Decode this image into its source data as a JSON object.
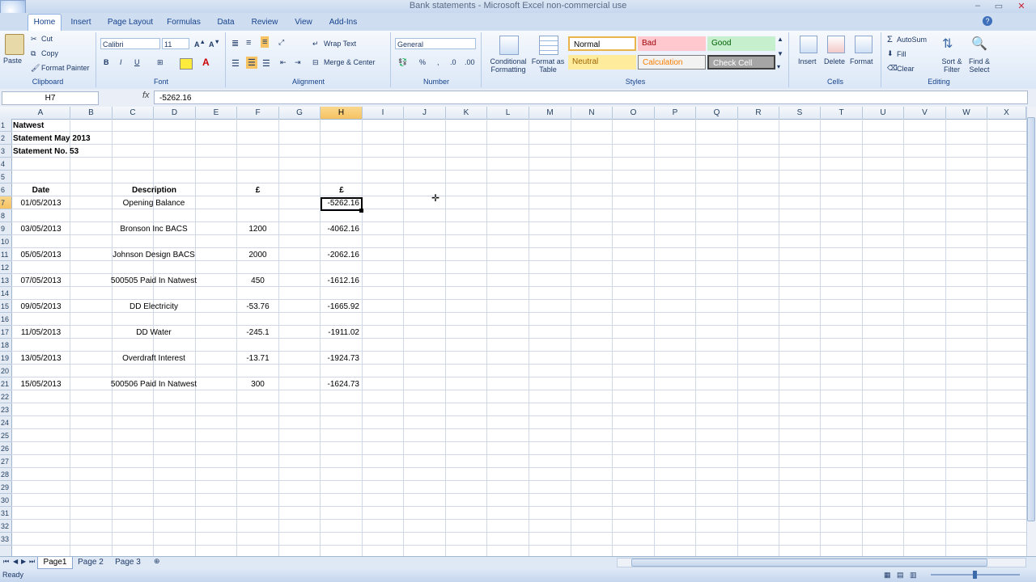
{
  "window": {
    "title": "Bank statements - Microsoft Excel non-commercial use",
    "controls": [
      "–",
      "▭",
      "✕"
    ]
  },
  "tabs": [
    "Home",
    "Insert",
    "Page Layout",
    "Formulas",
    "Data",
    "Review",
    "View",
    "Add-Ins"
  ],
  "ribbon": {
    "clipboard": {
      "label": "Clipboard",
      "paste": "Paste",
      "cut": "Cut",
      "copy": "Copy",
      "format_painter": "Format Painter"
    },
    "font": {
      "label": "Font",
      "name": "Calibri",
      "size": "11",
      "bold": "B",
      "italic": "I",
      "underline": "U"
    },
    "alignment": {
      "label": "Alignment",
      "wrap_text": "Wrap Text",
      "merge_center": "Merge & Center"
    },
    "number": {
      "label": "Number",
      "format": "General"
    },
    "styles": {
      "label": "Styles",
      "conditional": "Conditional Formatting",
      "format_table": "Format as Table",
      "normal": "Normal",
      "bad": "Bad",
      "good": "Good",
      "neutral": "Neutral",
      "calculation": "Calculation",
      "check_cell": "Check Cell"
    },
    "cells": {
      "label": "Cells",
      "insert": "Insert",
      "delete": "Delete",
      "format": "Format"
    },
    "editing": {
      "label": "Editing",
      "autosum": "AutoSum",
      "fill": "Fill",
      "clear": "Clear",
      "sort_filter": "Sort & Filter",
      "find_select": "Find & Select"
    }
  },
  "formula_bar": {
    "name_box": "H7",
    "fx": "fx",
    "value": "-5262.16"
  },
  "columns": [
    "A",
    "B",
    "C",
    "D",
    "E",
    "F",
    "G",
    "H",
    "I",
    "J",
    "K",
    "L",
    "M",
    "N",
    "O",
    "P",
    "Q",
    "R",
    "S",
    "T",
    "U",
    "V",
    "W",
    "X"
  ],
  "selected_column": "H",
  "selected_row": "7",
  "rows": [
    "1",
    "2",
    "3",
    "4",
    "5",
    "6",
    "7",
    "8",
    "9",
    "10",
    "11",
    "12",
    "13",
    "14",
    "15",
    "16",
    "17",
    "18",
    "19",
    "20",
    "21",
    "22",
    "23",
    "24",
    "25",
    "26",
    "27",
    "28",
    "29",
    "30",
    "31",
    "32",
    "33"
  ],
  "sheet": {
    "header": [
      "Natwest",
      "Statement May 2013",
      "Statement No. 53"
    ],
    "col_date": "Date",
    "col_desc": "Description",
    "col_amount": "£",
    "col_balance": "£",
    "entries": [
      {
        "date": "01/05/2013",
        "desc": "Opening Balance",
        "amount": "",
        "balance": "-5262.16"
      },
      {
        "date": "03/05/2013",
        "desc": "Bronson Inc BACS",
        "amount": "1200",
        "balance": "-4062.16"
      },
      {
        "date": "05/05/2013",
        "desc": "Johnson Design BACS",
        "amount": "2000",
        "balance": "-2062.16"
      },
      {
        "date": "07/05/2013",
        "desc": "500505 Paid In Natwest",
        "amount": "450",
        "balance": "-1612.16"
      },
      {
        "date": "09/05/2013",
        "desc": "DD Electricity",
        "amount": "-53.76",
        "balance": "-1665.92"
      },
      {
        "date": "11/05/2013",
        "desc": "DD Water",
        "amount": "-245.1",
        "balance": "-1911.02"
      },
      {
        "date": "13/05/2013",
        "desc": "Overdraft Interest",
        "amount": "-13.71",
        "balance": "-1924.73"
      },
      {
        "date": "15/05/2013",
        "desc": "500506 Paid In Natwest",
        "amount": "300",
        "balance": "-1624.73"
      }
    ]
  },
  "sheet_tabs": [
    "Page1",
    "Page 2",
    "Page 3"
  ],
  "active_sheet": "Page1",
  "status": {
    "text": "Ready"
  },
  "colors": {
    "ribbon": "#dbe7f7",
    "selected_header": "#f6c262",
    "grid": "#d0d7e5",
    "bad_fill": "#ffc7ce",
    "good_fill": "#c6efce",
    "neutral_fill": "#ffeb9c"
  }
}
